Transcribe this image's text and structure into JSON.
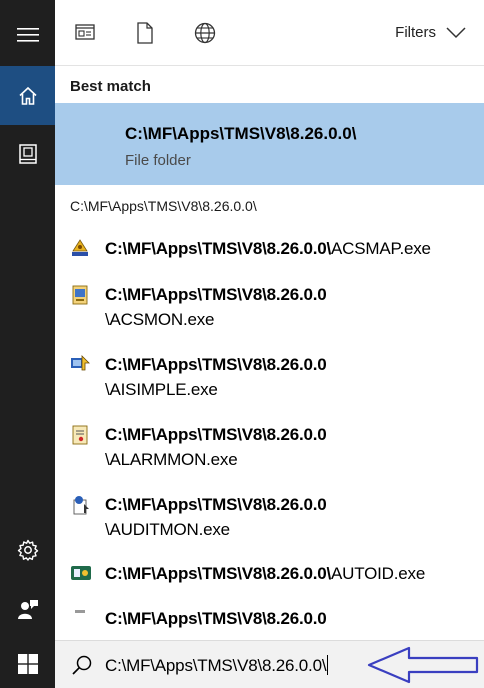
{
  "rail": {
    "items": [
      {
        "icon": "hamburger-icon"
      },
      {
        "icon": "home-icon",
        "active": true
      },
      {
        "icon": "documents-icon"
      },
      {
        "icon": "settings-icon"
      },
      {
        "icon": "user-feedback-icon"
      },
      {
        "icon": "windows-start-icon"
      }
    ]
  },
  "toolbar": {
    "icons": [
      "apps-icon",
      "documents-icon",
      "web-icon"
    ],
    "filters_label": "Filters"
  },
  "best_match": {
    "heading": "Best match",
    "title": "C:\\MF\\Apps\\TMS\\V8\\8.26.0.0\\",
    "subtitle": "File folder"
  },
  "group": {
    "heading": "C:\\MF\\Apps\\TMS\\V8\\8.26.0.0\\"
  },
  "results": [
    {
      "bold": "C:\\MF\\Apps\\TMS\\V8\\8.26.0.0\\",
      "rest": "ACSMAP.exe",
      "icon": "acsmap-app-icon"
    },
    {
      "bold": "C:\\MF\\Apps\\TMS\\V8\\8.26.0.0",
      "rest": "\\ACSMON.exe",
      "icon": "acsmon-app-icon"
    },
    {
      "bold": "C:\\MF\\Apps\\TMS\\V8\\8.26.0.0",
      "rest": "\\AISIMPLE.exe",
      "icon": "aisimple-app-icon"
    },
    {
      "bold": "C:\\MF\\Apps\\TMS\\V8\\8.26.0.0",
      "rest": "\\ALARMMON.exe",
      "icon": "alarmmon-app-icon"
    },
    {
      "bold": "C:\\MF\\Apps\\TMS\\V8\\8.26.0.0",
      "rest": "\\AUDITMON.exe",
      "icon": "auditmon-app-icon"
    },
    {
      "bold": "C:\\MF\\Apps\\TMS\\V8\\8.26.0.0\\",
      "rest": "AUTOID.exe",
      "icon": "autoid-app-icon"
    },
    {
      "bold": "C:\\MF\\Apps\\TMS\\V8\\8.26.0.0",
      "rest": "",
      "icon": "app-icon"
    }
  ],
  "search": {
    "value": "C:\\MF\\Apps\\TMS\\V8\\8.26.0.0\\"
  },
  "colors": {
    "rail": "#1f1f1f",
    "active": "#1e4e82",
    "highlight": "#a8cbeb",
    "annotation_arrow": "#3a3fc0"
  }
}
